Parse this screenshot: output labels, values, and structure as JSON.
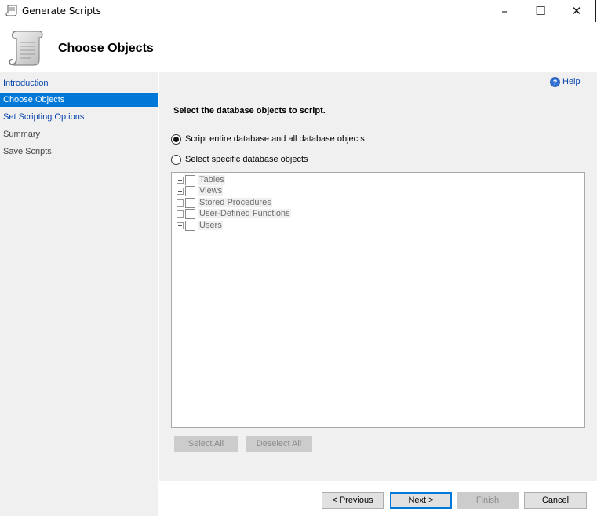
{
  "window": {
    "title": "Generate Scripts",
    "minimize_glyph": "–",
    "maximize_glyph": "☐",
    "close_glyph": "✕"
  },
  "header": {
    "title": "Choose Objects",
    "icon": "scroll-icon"
  },
  "sidebar": {
    "items": [
      {
        "label": "Introduction",
        "state": "link"
      },
      {
        "label": "Choose Objects",
        "state": "active"
      },
      {
        "label": "Set Scripting Options",
        "state": "link"
      },
      {
        "label": "Summary",
        "state": "disabled"
      },
      {
        "label": "Save Scripts",
        "state": "disabled"
      }
    ]
  },
  "main": {
    "help_label": "Help",
    "prompt": "Select the database objects to script.",
    "options": [
      {
        "label": "Script entire database and all database objects",
        "selected": true
      },
      {
        "label": "Select specific database objects",
        "selected": false
      }
    ],
    "tree_items": [
      "Tables",
      "Views",
      "Stored Procedures",
      "User-Defined Functions",
      "Users"
    ],
    "select_all_label": "Select All",
    "deselect_all_label": "Deselect All"
  },
  "footer": {
    "previous_label": "< Previous",
    "next_label": "Next >",
    "finish_label": "Finish",
    "cancel_label": "Cancel"
  },
  "colors": {
    "accent": "#0078d7",
    "link": "#0645ad",
    "panel": "#f0f0f0"
  }
}
